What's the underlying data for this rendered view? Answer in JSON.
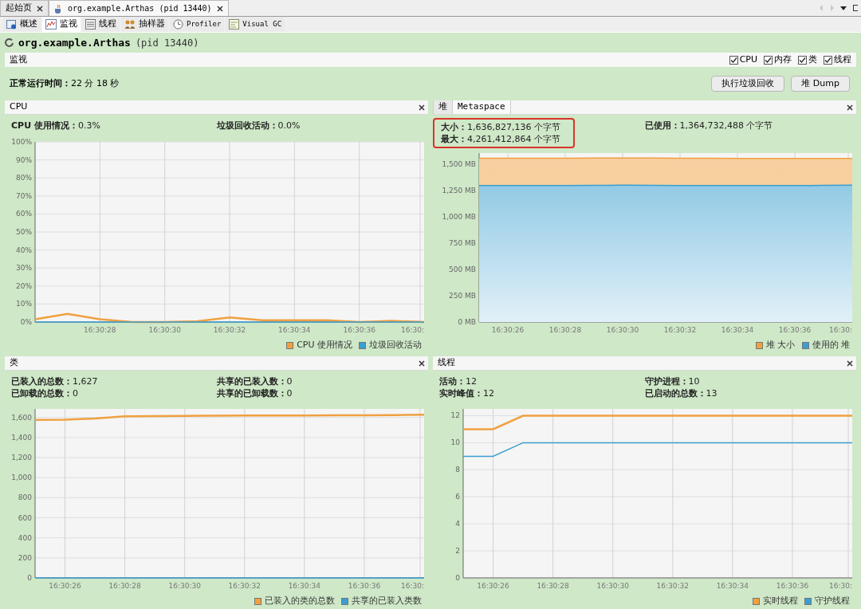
{
  "document_tabs": [
    {
      "label": "起始页",
      "selected": false
    },
    {
      "label": "org.example.Arthas (pid 13440)",
      "selected": true
    }
  ],
  "view_tabs": [
    {
      "label": "概述",
      "kind": "overview",
      "selected": false
    },
    {
      "label": "监视",
      "kind": "monitor",
      "selected": true
    },
    {
      "label": "线程",
      "kind": "threads",
      "selected": false
    },
    {
      "label": "抽样器",
      "kind": "sampler",
      "selected": false
    },
    {
      "label": "Profiler",
      "kind": "profiler",
      "selected": false
    },
    {
      "label": "Visual GC",
      "kind": "gc",
      "selected": false
    }
  ],
  "app_title": {
    "name": "org.example.Arthas",
    "pid": "(pid 13440)"
  },
  "section": {
    "title": "监视",
    "toggles": [
      {
        "label": "CPU",
        "checked": true
      },
      {
        "label": "内存",
        "checked": true
      },
      {
        "label": "类",
        "checked": true
      },
      {
        "label": "线程",
        "checked": true
      }
    ]
  },
  "uptime": "**正常运行时间：**22 分 18 秒",
  "buttons": [
    "执行垃圾回收",
    "堆 Dump"
  ],
  "panels": [
    {
      "title": "CPU",
      "highlight": false,
      "stats": [
        "**CPU 使用情况：**0.3%",
        "**垃圾回收活动：**0.0%"
      ],
      "axis_end_label": "16:30:",
      "chart_data": {
        "type": "line",
        "categories": [
          null,
          null,
          "16:30:28",
          null,
          "16:30:30",
          null,
          "16:30:32",
          null,
          "16:30:34",
          null,
          "16:30:36",
          null,
          null
        ],
        "grid": true,
        "ylim": [
          0,
          100
        ],
        "yticks": [
          {
            "value": 0,
            "label": "0%"
          },
          {
            "value": 10,
            "label": "10%"
          },
          {
            "value": 20,
            "label": "20%"
          },
          {
            "value": 30,
            "label": "30%"
          },
          {
            "value": 40,
            "label": "40%"
          },
          {
            "value": 50,
            "label": "50%"
          },
          {
            "value": 60,
            "label": "60%"
          },
          {
            "value": 70,
            "label": "70%"
          },
          {
            "value": 80,
            "label": "80%"
          },
          {
            "value": 90,
            "label": "90%"
          },
          {
            "value": 100,
            "label": "100%"
          }
        ],
        "series": [
          {
            "name": "CPU 使用情况",
            "color": "#f0a040",
            "values": [
              1.5,
              4.5,
              1.5,
              0,
              0,
              0.5,
              2.5,
              1,
              1,
              1,
              0,
              0.7,
              0
            ]
          },
          {
            "name": "垃圾回收活动",
            "color": "#3a9fd0",
            "values": [
              0,
              0,
              0,
              0,
              0,
              0,
              0,
              0,
              0,
              0,
              0,
              0,
              0
            ]
          }
        ]
      }
    },
    {
      "tabs": [
        {
          "label": "堆",
          "selected": true
        },
        {
          "label": "Metaspace",
          "selected": false
        }
      ],
      "highlight": true,
      "stats": [
        "**大小：**1,636,827,136 个字节",
        "**已使用：**1,364,732,488 个字节",
        "**最大：**4,261,412,864 个字节"
      ],
      "axis_end_label": "16:30:",
      "chart_data": {
        "type": "area",
        "categories": [
          null,
          "16:30:26",
          null,
          "16:30:28",
          null,
          "16:30:30",
          null,
          "16:30:32",
          null,
          "16:30:34",
          null,
          "16:30:36",
          null,
          null
        ],
        "grid": true,
        "ylim": [
          0,
          1610
        ],
        "yticks": [
          {
            "value": 0,
            "label": "0 MB"
          },
          {
            "value": 250,
            "label": "250 MB"
          },
          {
            "value": 500,
            "label": "500 MB"
          },
          {
            "value": 750,
            "label": "750 MB"
          },
          {
            "value": 1000,
            "label": "1,000 MB"
          },
          {
            "value": 1250,
            "label": "1,250 MB"
          },
          {
            "value": 1500,
            "label": "1,500 MB"
          }
        ],
        "series": [
          {
            "name": "堆 大小",
            "color": "#f0a040",
            "values": [
              1561,
              1561,
              1561,
              1561,
              1562,
              1563,
              1562,
              1561,
              1560,
              1558,
              1558,
              1558,
              1558,
              1558
            ]
          },
          {
            "name": "使用的 堆",
            "color": "#3a9fd0",
            "values": [
              1300,
              1300,
              1300,
              1300,
              1302,
              1305,
              1303,
              1300,
              1300,
              1300,
              1300,
              1300,
              1302,
              1305
            ]
          }
        ]
      }
    },
    {
      "title": "类",
      "highlight": false,
      "stats": [
        "**已装入的总数：**1,627",
        "**共享的已装入数：**0",
        "**已卸载的总数：**0",
        "**共享的已卸载数：**0"
      ],
      "axis_end_label": "16:30:",
      "chart_data": {
        "type": "line",
        "categories": [
          null,
          "16:30:26",
          null,
          "16:30:28",
          null,
          "16:30:30",
          null,
          "16:30:32",
          null,
          "16:30:34",
          null,
          "16:30:36",
          null,
          null
        ],
        "grid": true,
        "ylim": [
          0,
          1685
        ],
        "yticks": [
          {
            "value": 0,
            "label": "0"
          },
          {
            "value": 200,
            "label": "200"
          },
          {
            "value": 400,
            "label": "400"
          },
          {
            "value": 600,
            "label": "600"
          },
          {
            "value": 800,
            "label": "800"
          },
          {
            "value": 1000,
            "label": "1,000"
          },
          {
            "value": 1200,
            "label": "1,200"
          },
          {
            "value": 1400,
            "label": "1,400"
          },
          {
            "value": 1600,
            "label": "1,600"
          }
        ],
        "series": [
          {
            "name": "已装入的类的总数",
            "color": "#f0a040",
            "values": [
              1575,
              1577,
              1590,
              1612,
              1614,
              1615,
              1618,
              1620,
              1620,
              1620,
              1621,
              1621,
              1624,
              1627
            ]
          },
          {
            "name": "共享的已装入类数",
            "color": "#3a9fd0",
            "values": [
              0,
              0,
              0,
              0,
              0,
              0,
              0,
              0,
              0,
              0,
              0,
              0,
              0,
              0
            ]
          }
        ]
      }
    },
    {
      "title": "线程",
      "highlight": false,
      "stats": [
        "**活动：**12",
        "**守护进程：**10",
        "**实时峰值：**12",
        "**已启动的总数：**13"
      ],
      "axis_end_label": "16:30:",
      "chart_data": {
        "type": "line",
        "categories": [
          null,
          "16:30:26",
          null,
          "16:30:28",
          null,
          "16:30:30",
          null,
          "16:30:32",
          null,
          "16:30:34",
          null,
          "16:30:36",
          null,
          null
        ],
        "grid": true,
        "ylim": [
          0,
          12.5
        ],
        "yticks": [
          0,
          2,
          4,
          6,
          8,
          10,
          12
        ],
        "series": [
          {
            "name": "实时线程",
            "color": "#f0a040",
            "values": [
              11,
              11,
              12,
              12,
              12,
              12,
              12,
              12,
              12,
              12,
              12,
              12,
              12,
              12
            ]
          },
          {
            "name": "守护线程",
            "color": "#3a9fd0",
            "values": [
              9,
              9,
              10,
              10,
              10,
              10,
              10,
              10,
              10,
              10,
              10,
              10,
              10,
              10
            ]
          }
        ]
      }
    }
  ]
}
